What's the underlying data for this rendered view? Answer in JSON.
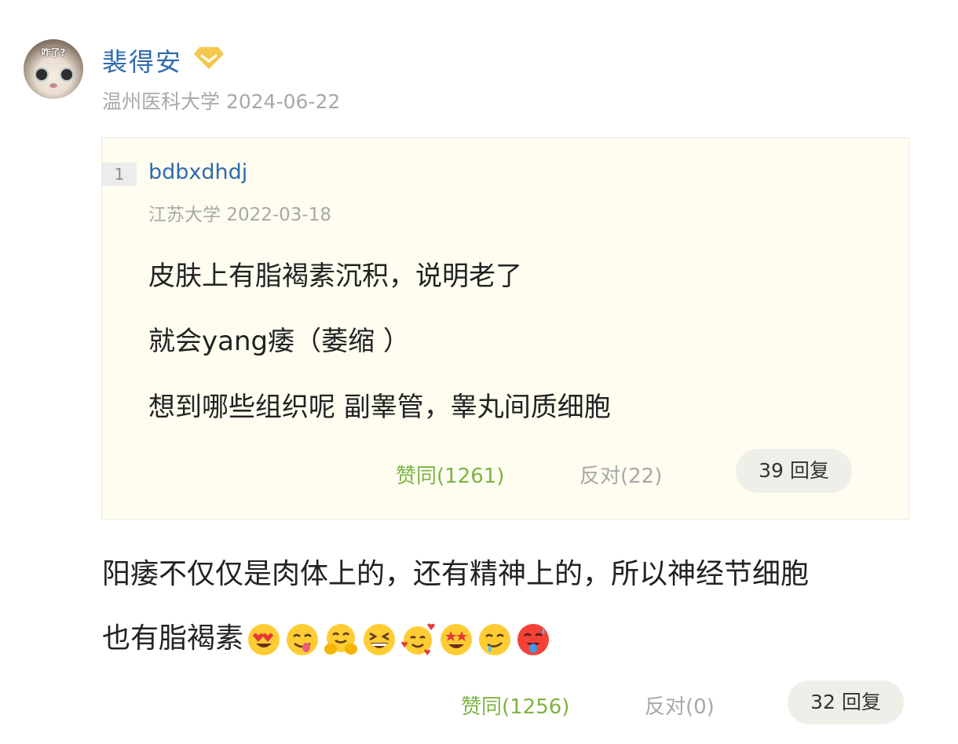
{
  "comment": {
    "author": {
      "name": "裴得安",
      "avatar_caption": "咋了?",
      "school": "温州医科大学",
      "date": "2024-06-22",
      "badge_icon": "diamond-badge-icon",
      "badge_color": "#f2c94c"
    },
    "quote": {
      "index": "1",
      "author": "bdbxdhdj",
      "school": "江苏大学",
      "date": "2022-03-18",
      "lines": [
        "皮肤上有脂褐素沉积，说明老了",
        "就会yang痿（萎缩 ）",
        "想到哪些组织呢 副睾管，睾丸间质细胞"
      ],
      "agree_label": "赞同(1261)",
      "disagree_label": "反对(22)",
      "reply_label": "39 回复"
    },
    "body": {
      "line1": "阳痿不仅仅是肉体上的，还有精神上的，所以神经节细胞",
      "line2": "也有脂褐素",
      "emojis": [
        "heart-eyes-emoji",
        "yum-emoji",
        "hugging-emoji",
        "laughing-emoji",
        "smiling-hearts-emoji",
        "star-struck-emoji",
        "drooling-emoji",
        "hot-face-emoji"
      ]
    },
    "actions": {
      "agree_label": "赞同(1256)",
      "disagree_label": "反对(0)",
      "reply_label": "32 回复"
    },
    "colors": {
      "link_blue": "#2e6ab0",
      "agree_green": "#7cb342",
      "meta_gray": "#a8a8a8",
      "quote_bg": "#fefdf0"
    }
  }
}
